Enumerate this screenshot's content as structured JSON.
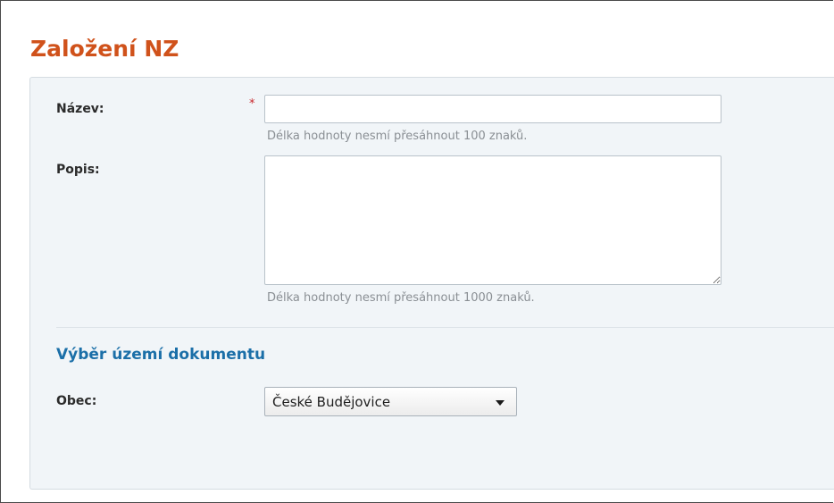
{
  "page": {
    "title": "Založení NZ"
  },
  "form": {
    "name": {
      "label": "Název:",
      "required_mark": "*",
      "value": "",
      "hint": "Délka hodnoty nesmí přesáhnout 100 znaků."
    },
    "description": {
      "label": "Popis:",
      "value": "",
      "hint": "Délka hodnoty nesmí přesáhnout 1000 znaků."
    },
    "territory_section": {
      "heading": "Výběr území dokumentu"
    },
    "municipality": {
      "label": "Obec:",
      "selected": "České Budějovice",
      "icon": "chevron-down-icon"
    }
  },
  "colors": {
    "title": "#d0521b",
    "section_heading": "#1b6fa8",
    "required": "#c8262b",
    "panel_background": "#f1f5f8"
  }
}
